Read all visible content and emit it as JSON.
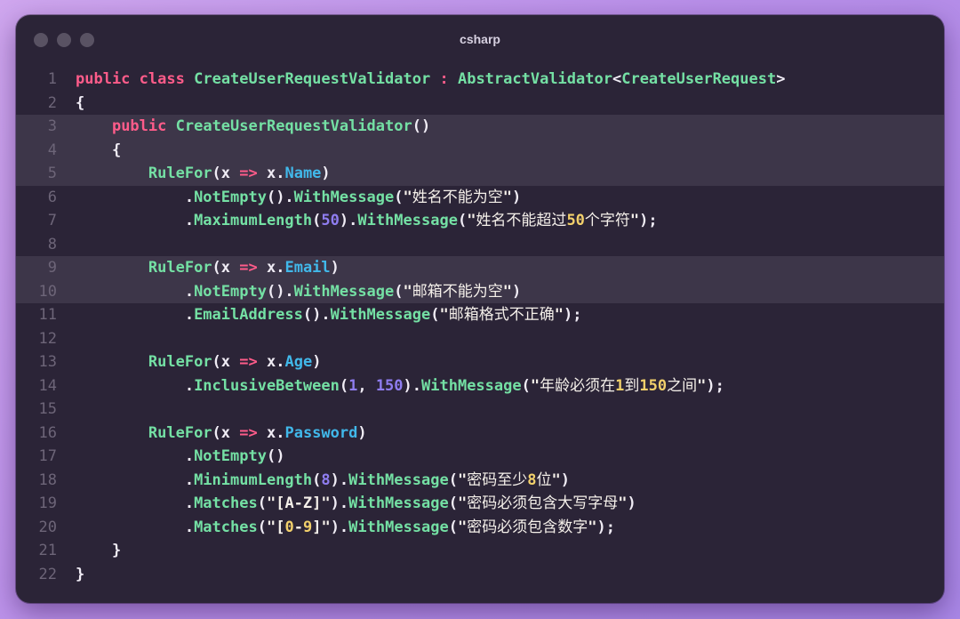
{
  "window": {
    "title": "csharp",
    "controls": [
      "close",
      "minimize",
      "maximize"
    ]
  },
  "code": {
    "language": "csharp",
    "highlighted_lines": [
      3,
      4,
      5,
      9,
      10
    ],
    "lines": [
      {
        "n": "1",
        "text": "public class CreateUserRequestValidator : AbstractValidator<CreateUserRequest>"
      },
      {
        "n": "2",
        "text": "{"
      },
      {
        "n": "3",
        "text": "    public CreateUserRequestValidator()"
      },
      {
        "n": "4",
        "text": "    {"
      },
      {
        "n": "5",
        "text": "        RuleFor(x => x.Name)"
      },
      {
        "n": "6",
        "text": "            .NotEmpty().WithMessage(\"姓名不能为空\")"
      },
      {
        "n": "7",
        "text": "            .MaximumLength(50).WithMessage(\"姓名不能超过50个字符\");"
      },
      {
        "n": "8",
        "text": ""
      },
      {
        "n": "9",
        "text": "        RuleFor(x => x.Email)"
      },
      {
        "n": "10",
        "text": "            .NotEmpty().WithMessage(\"邮箱不能为空\")"
      },
      {
        "n": "11",
        "text": "            .EmailAddress().WithMessage(\"邮箱格式不正确\");"
      },
      {
        "n": "12",
        "text": ""
      },
      {
        "n": "13",
        "text": "        RuleFor(x => x.Age)"
      },
      {
        "n": "14",
        "text": "            .InclusiveBetween(1, 150).WithMessage(\"年龄必须在1到150之间\");"
      },
      {
        "n": "15",
        "text": ""
      },
      {
        "n": "16",
        "text": "        RuleFor(x => x.Password)"
      },
      {
        "n": "17",
        "text": "            .NotEmpty()"
      },
      {
        "n": "18",
        "text": "            .MinimumLength(8).WithMessage(\"密码至少8位\")"
      },
      {
        "n": "19",
        "text": "            .Matches(\"[A-Z]\").WithMessage(\"密码必须包含大写字母\")"
      },
      {
        "n": "20",
        "text": "            .Matches(\"[0-9]\").WithMessage(\"密码必须包含数字\");"
      },
      {
        "n": "21",
        "text": "    }"
      },
      {
        "n": "22",
        "text": "}"
      }
    ]
  }
}
